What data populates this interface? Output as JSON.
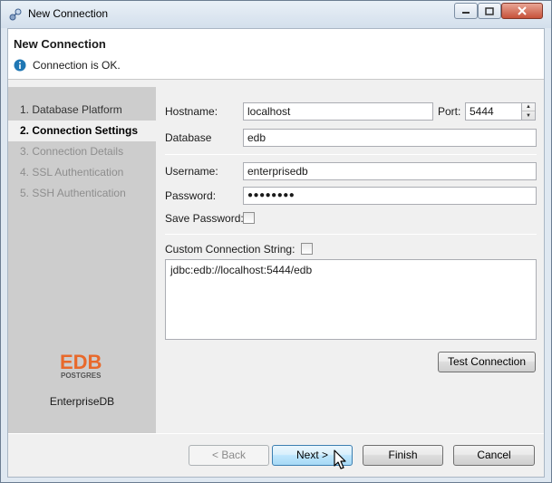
{
  "window": {
    "title": "New Connection"
  },
  "header": {
    "title": "New Connection",
    "message": "Connection is OK."
  },
  "steps": [
    {
      "label": "1. Database Platform",
      "state": "done"
    },
    {
      "label": "2. Connection Settings",
      "state": "active"
    },
    {
      "label": "3. Connection Details",
      "state": "disabled"
    },
    {
      "label": "4. SSL Authentication",
      "state": "disabled"
    },
    {
      "label": "5. SSH Authentication",
      "state": "disabled"
    }
  ],
  "brand": {
    "logo_text": "EDB",
    "logo_sub": "POSTGRES",
    "name": "EnterpriseDB"
  },
  "form": {
    "hostname_label": "Hostname:",
    "hostname_value": "localhost",
    "port_label": "Port:",
    "port_value": "5444",
    "database_label": "Database",
    "database_value": "edb",
    "username_label": "Username:",
    "username_value": "enterprisedb",
    "password_label": "Password:",
    "password_value": "●●●●●●●●",
    "save_password_label": "Save Password:",
    "save_password_checked": false,
    "custom_string_label": "Custom Connection String:",
    "custom_string_checked": false,
    "connection_string": "jdbc:edb://localhost:5444/edb",
    "test_button": "Test Connection"
  },
  "footer": {
    "back": "< Back",
    "next": "Next >",
    "finish": "Finish",
    "cancel": "Cancel"
  },
  "colors": {
    "edb_orange": "#e8692b",
    "info_blue": "#1f77b4"
  }
}
